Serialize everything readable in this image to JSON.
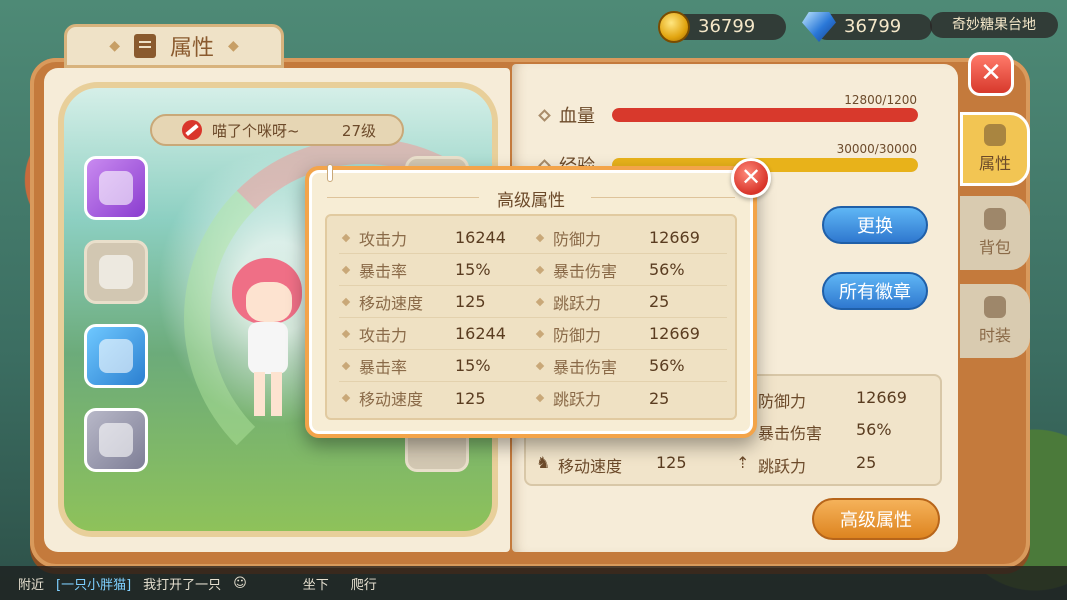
{
  "currency": {
    "gold": "36799",
    "diamond": "36799"
  },
  "location": "奇妙糖果台地",
  "panel": {
    "title": "属性"
  },
  "character": {
    "name": "喵了个咪呀~",
    "level": "27级"
  },
  "stats": {
    "hp_label": "血量",
    "hp_value": "12800/1200",
    "hp_fraction": 1.0,
    "exp_label": "经验",
    "exp_value": "30000/30000",
    "exp_fraction": 1.0
  },
  "buttons": {
    "change": "更换",
    "all_badges": "所有徽章",
    "advanced": "高级属性"
  },
  "basic_stats": {
    "row1": {
      "k1": "防御力",
      "v1": "12669"
    },
    "row2": {
      "k1": "暴击伤害",
      "v1": "56%"
    },
    "row3": {
      "k1": "移动速度",
      "v1": "125",
      "k2": "跳跃力",
      "v2": "25"
    }
  },
  "side_tabs": [
    "属性",
    "背包",
    "时装"
  ],
  "chat": {
    "channel": "附近",
    "name": "[一只小胖猫]",
    "message": "我打开了一只",
    "action1": "坐下",
    "action2": "爬行"
  },
  "modal": {
    "title": "高级属性",
    "rows": [
      {
        "k1": "攻击力",
        "v1": "16244",
        "k2": "防御力",
        "v2": "12669"
      },
      {
        "k1": "暴击率",
        "v1": "15%",
        "k2": "暴击伤害",
        "v2": "56%"
      },
      {
        "k1": "移动速度",
        "v1": "125",
        "k2": "跳跃力",
        "v2": "25"
      },
      {
        "k1": "攻击力",
        "v1": "16244",
        "k2": "防御力",
        "v2": "12669"
      },
      {
        "k1": "暴击率",
        "v1": "15%",
        "k2": "暴击伤害",
        "v2": "56%"
      },
      {
        "k1": "移动速度",
        "v1": "125",
        "k2": "跳跃力",
        "v2": "25"
      }
    ]
  },
  "colors": {
    "hp_bar": "#d8392c",
    "exp_bar": "#e8b21a",
    "accent_orange": "#f3a44a"
  }
}
